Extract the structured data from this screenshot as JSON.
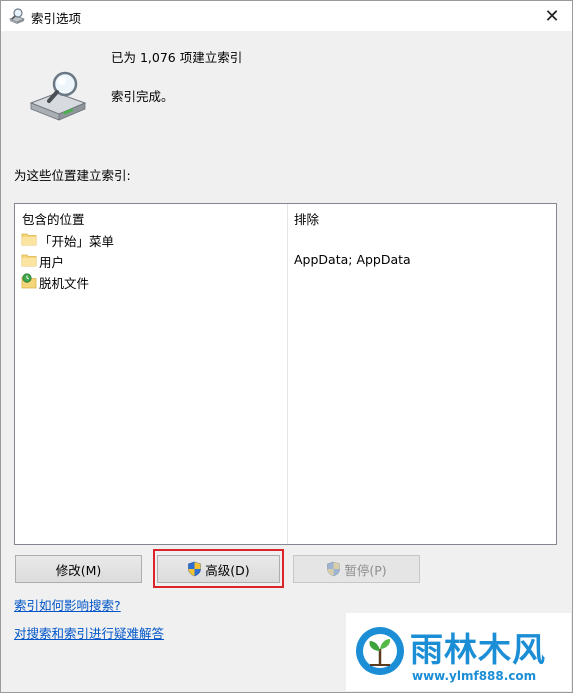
{
  "window": {
    "title": "索引选项",
    "close_glyph": "✕"
  },
  "status": {
    "count_text": "已为 1,076 项建立索引",
    "message": "索引完成。"
  },
  "section_label": "为这些位置建立索引:",
  "list": {
    "col_locations": "包含的位置",
    "col_exclude": "排除",
    "rows": [
      {
        "name": "「开始」菜单",
        "exclude": "",
        "icon": "folder-icon"
      },
      {
        "name": "用户",
        "exclude": "AppData; AppData",
        "icon": "folder-icon"
      },
      {
        "name": "脱机文件",
        "exclude": "",
        "icon": "offline-files-icon"
      }
    ]
  },
  "buttons": {
    "modify": "修改(M)",
    "advanced": "高级(D)",
    "pause": "暂停(P)"
  },
  "links": {
    "how_index_affects": "索引如何影响搜索?",
    "troubleshoot": "对搜索和索引进行疑难解答"
  },
  "watermark": {
    "title": "雨林木风",
    "url": "www.ylmf888.com"
  },
  "colors": {
    "accent_link": "#0055c8",
    "highlight_border": "#d9242a",
    "brand": "#1c8ed6"
  }
}
